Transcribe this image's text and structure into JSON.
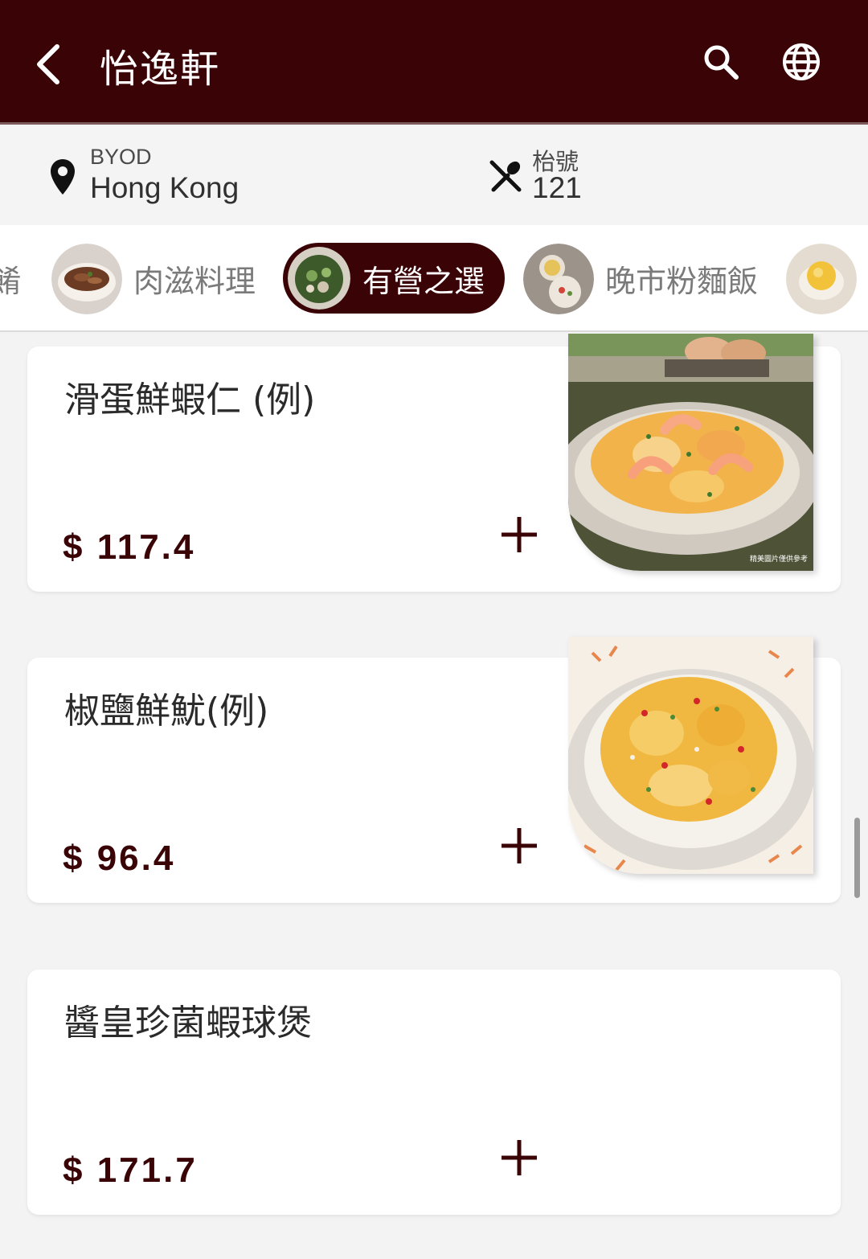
{
  "header": {
    "title": "怡逸軒",
    "back_icon": "back-arrow-icon",
    "search_icon": "search-icon",
    "language_icon": "globe-icon",
    "background": "#3a0306"
  },
  "info": {
    "store_label": "BYOD",
    "store_name": "Hong Kong",
    "table_label": "枱號",
    "table_number": "121"
  },
  "categories": {
    "partial_left": "餚",
    "items": [
      {
        "label": "肉滋料理",
        "active": false
      },
      {
        "label": "有營之選",
        "active": true
      },
      {
        "label": "晚市粉麵飯",
        "active": false
      }
    ],
    "accent": "#3a0306"
  },
  "dishes": [
    {
      "name": "滑蛋鮮蝦仁 (例)",
      "price": "$ 117.4",
      "image_note": "精美圖片僅供參考"
    },
    {
      "name": "椒鹽鮮魷(例)",
      "price": "$ 96.4"
    },
    {
      "name": "醬皇珍菌蝦球煲",
      "price": "$ 171.7"
    }
  ]
}
